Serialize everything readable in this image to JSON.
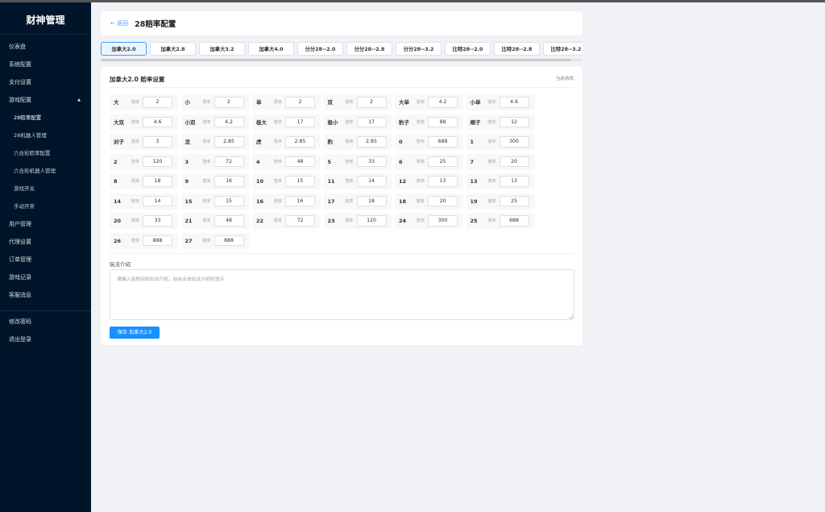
{
  "sidebar": {
    "brand": "财神管理",
    "items": [
      {
        "label": "仪表盘"
      },
      {
        "label": "系统配置"
      },
      {
        "label": "支付设置"
      },
      {
        "label": "游戏配置",
        "caret": "▲"
      },
      {
        "label": "28赔率配置",
        "sub": true,
        "active": true
      },
      {
        "label": "28机器人管理",
        "sub": true
      },
      {
        "label": "六合彩赔率配置",
        "sub": true
      },
      {
        "label": "六合彩机器人管理",
        "sub": true
      },
      {
        "label": "游戏开关",
        "sub": true
      },
      {
        "label": "手动开奖",
        "sub": true
      },
      {
        "label": "用户管理"
      },
      {
        "label": "代理设置"
      },
      {
        "label": "订单管理"
      },
      {
        "label": "游戏记录"
      },
      {
        "label": "客服消息"
      }
    ],
    "bottom_items": [
      {
        "label": "修改密码"
      },
      {
        "label": "退出登录"
      }
    ]
  },
  "header": {
    "back_label": "← 返回",
    "title": "28赔率配置"
  },
  "tabs": [
    {
      "label": "加拿大2.0",
      "active": true
    },
    {
      "label": "加拿大2.8"
    },
    {
      "label": "加拿大3.2"
    },
    {
      "label": "加拿大4.0"
    },
    {
      "label": "分分28--2.0"
    },
    {
      "label": "分分28--2.8"
    },
    {
      "label": "分分28--3.2"
    },
    {
      "label": "比特28--2.0"
    },
    {
      "label": "比特28--2.8"
    },
    {
      "label": "比特28--3.2"
    }
  ],
  "settings": {
    "title": "加拿大2.0 赔率设置",
    "link": "当前游戏",
    "odds_label": "赔率",
    "rows": [
      [
        {
          "name": "大",
          "value": "2"
        },
        {
          "name": "小",
          "value": "2"
        },
        {
          "name": "单",
          "value": "2"
        },
        {
          "name": "双",
          "value": "2"
        },
        {
          "name": "大单",
          "value": "4.2"
        },
        {
          "name": "小单",
          "value": "4.6"
        }
      ],
      [
        {
          "name": "大双",
          "value": "4.6"
        },
        {
          "name": "小双",
          "value": "4.2"
        },
        {
          "name": "极大",
          "value": "17"
        },
        {
          "name": "极小",
          "value": "17"
        },
        {
          "name": "豹子",
          "value": "88"
        },
        {
          "name": "顺子",
          "value": "12"
        }
      ],
      [
        {
          "name": "对子",
          "value": "3"
        },
        {
          "name": "龙",
          "value": "2.85"
        },
        {
          "name": "虎",
          "value": "2.85"
        },
        {
          "name": "豹",
          "value": "2.85"
        },
        {
          "name": "0",
          "value": "688"
        },
        {
          "name": "1",
          "value": "300"
        }
      ],
      [
        {
          "name": "2",
          "value": "120"
        },
        {
          "name": "3",
          "value": "72"
        },
        {
          "name": "4",
          "value": "48"
        },
        {
          "name": "5",
          "value": "33"
        },
        {
          "name": "6",
          "value": "25"
        },
        {
          "name": "7",
          "value": "20"
        }
      ],
      [
        {
          "name": "8",
          "value": "18"
        },
        {
          "name": "9",
          "value": "16"
        },
        {
          "name": "10",
          "value": "15"
        },
        {
          "name": "11",
          "value": "14"
        },
        {
          "name": "12",
          "value": "13"
        },
        {
          "name": "13",
          "value": "13"
        }
      ],
      [
        {
          "name": "14",
          "value": "14"
        },
        {
          "name": "15",
          "value": "15"
        },
        {
          "name": "16",
          "value": "16"
        },
        {
          "name": "17",
          "value": "18"
        },
        {
          "name": "18",
          "value": "20"
        },
        {
          "name": "19",
          "value": "25"
        }
      ],
      [
        {
          "name": "20",
          "value": "33"
        },
        {
          "name": "21",
          "value": "48"
        },
        {
          "name": "22",
          "value": "72"
        },
        {
          "name": "23",
          "value": "120"
        },
        {
          "name": "24",
          "value": "300"
        },
        {
          "name": "25",
          "value": "688"
        }
      ],
      [
        {
          "name": "26",
          "value": "888"
        },
        {
          "name": "27",
          "value": "888"
        }
      ]
    ],
    "intro_label": "玩法介绍",
    "intro_placeholder": "请输入该房间的玩法介绍，前台点击玩法介绍时显示",
    "intro_value": "",
    "save_label": "保存 加拿大2.0"
  },
  "colors": {
    "sidebar_bg": "#001529",
    "primary": "#1890ff",
    "link": "#409eff",
    "page_bg": "#f0f2f5"
  }
}
